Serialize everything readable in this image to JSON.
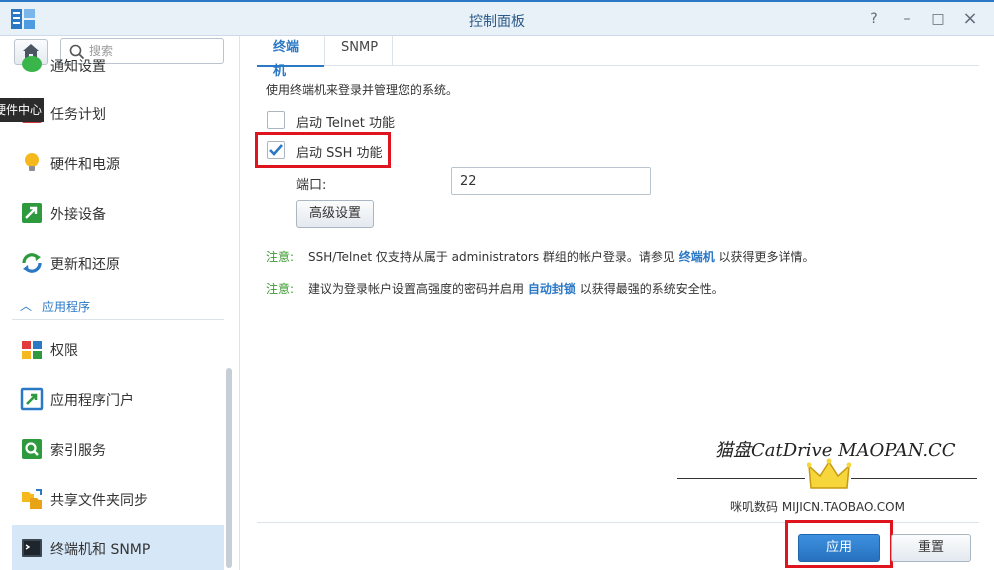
{
  "window": {
    "title": "控制面板",
    "controls": {
      "help": "?",
      "minimize": "–",
      "maximize": "□",
      "close": "×"
    }
  },
  "sidebar": {
    "search_placeholder": "搜索",
    "tooltip": "硬件中心",
    "items_top": [
      {
        "label": "通知设置",
        "icon": "chat-bubble-icon"
      },
      {
        "label": "任务计划",
        "icon": "calendar-icon"
      },
      {
        "label": "硬件和电源",
        "icon": "lightbulb-icon"
      },
      {
        "label": "外接设备",
        "icon": "external-device-icon"
      },
      {
        "label": "更新和还原",
        "icon": "update-icon"
      }
    ],
    "section_label": "应用程序",
    "items_apps": [
      {
        "label": "权限",
        "icon": "permissions-icon"
      },
      {
        "label": "应用程序门户",
        "icon": "app-portal-icon"
      },
      {
        "label": "索引服务",
        "icon": "index-search-icon"
      },
      {
        "label": "共享文件夹同步",
        "icon": "folder-sync-icon"
      },
      {
        "label": "终端机和 SNMP",
        "icon": "terminal-icon",
        "active": true
      }
    ]
  },
  "tabs": [
    {
      "label": "终端机",
      "active": true
    },
    {
      "label": "SNMP",
      "active": false
    }
  ],
  "terminal": {
    "description": "使用终端机来登录并管理您的系统。",
    "telnet_label": "启动 Telnet 功能",
    "telnet_checked": false,
    "ssh_label": "启动 SSH 功能",
    "ssh_checked": true,
    "port_label": "端口:",
    "port_value": "22",
    "advanced_button": "高级设置",
    "note1": {
      "prefix": "注意:",
      "text_before": "SSH/Telnet 仅支持从属于 administrators 群组的帐户登录。请参见 ",
      "link": "终端机",
      "text_after": " 以获得更多详情。"
    },
    "note2": {
      "prefix": "注意:",
      "text_before": "建议为登录帐户设置高强度的密码并启用 ",
      "link": "自动封锁",
      "text_after": " 以获得最强的系统安全性。"
    }
  },
  "watermark": {
    "title": "猫盘CatDrive MAOPAN.CC",
    "subtitle": "咪叽数码 MIJICN.TAOBAO.COM"
  },
  "footer": {
    "apply_button": "应用",
    "reset_button": "重置"
  },
  "colors": {
    "accent": "#2b78c5",
    "highlight_red": "#e0141e",
    "note_green": "#3a9a2f",
    "active_item_bg": "#d6e7f7"
  }
}
